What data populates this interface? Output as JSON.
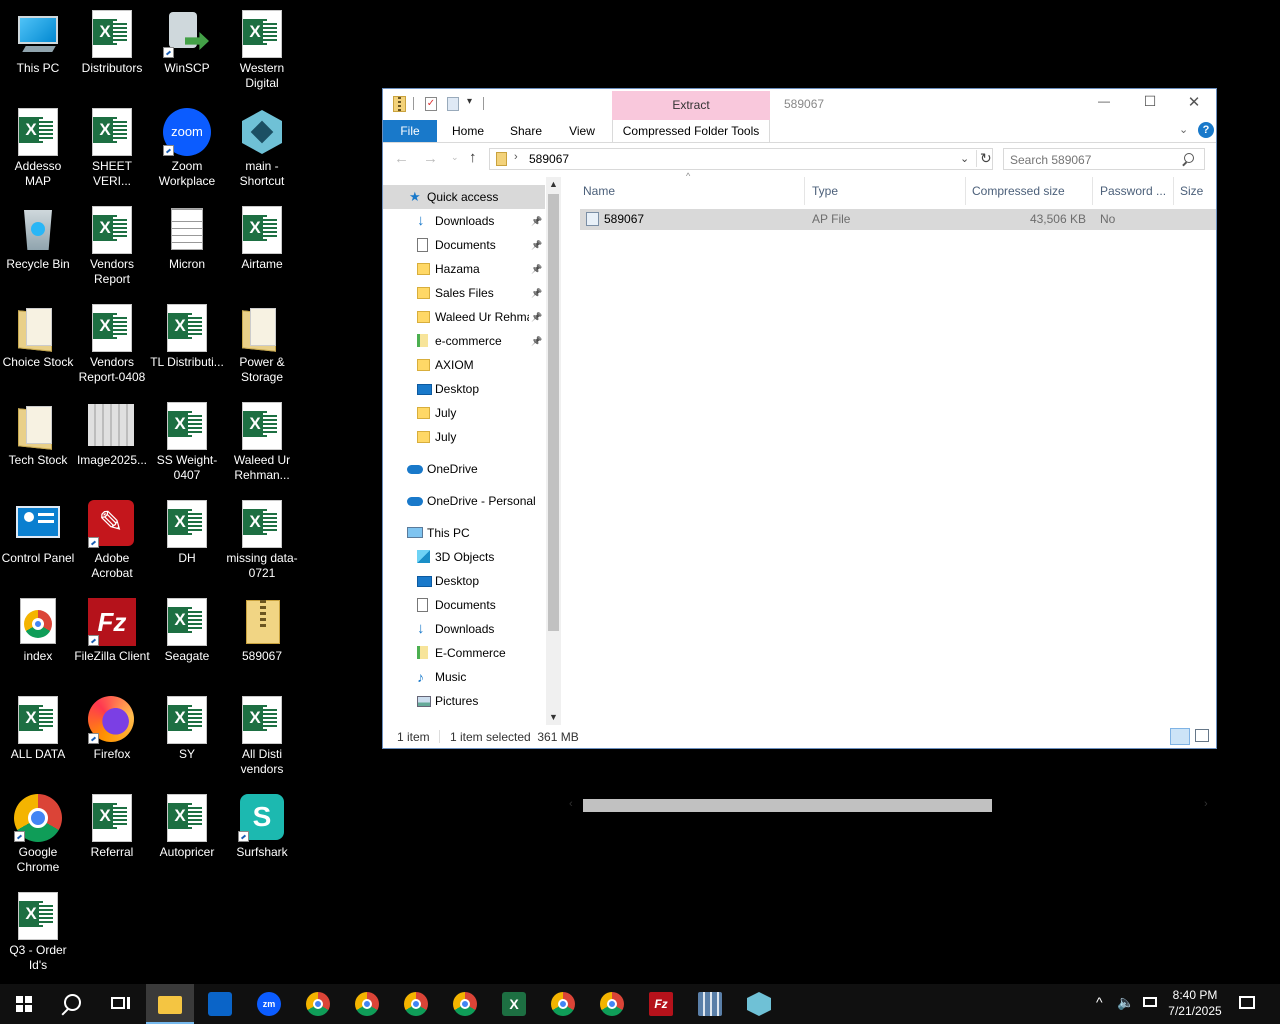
{
  "desktop": {
    "icons": [
      {
        "label": "This PC",
        "type": "pc",
        "shortcut": false
      },
      {
        "label": "Distributors",
        "type": "excel",
        "shortcut": false
      },
      {
        "label": "WinSCP",
        "type": "winscp",
        "shortcut": true
      },
      {
        "label": "Western Digital",
        "type": "excel",
        "shortcut": false
      },
      {
        "label": "Addesso MAP",
        "type": "excel",
        "shortcut": false
      },
      {
        "label": "SHEET VERI...",
        "type": "excel",
        "shortcut": false
      },
      {
        "label": "Zoom Workplace",
        "type": "zoom",
        "shortcut": true
      },
      {
        "label": "main - Shortcut",
        "type": "main",
        "shortcut": false
      },
      {
        "label": "Recycle Bin",
        "type": "recycle",
        "shortcut": false
      },
      {
        "label": "Vendors Report",
        "type": "excel",
        "shortcut": false
      },
      {
        "label": "Micron",
        "type": "doc",
        "shortcut": false
      },
      {
        "label": "Airtame",
        "type": "excel",
        "shortcut": false
      },
      {
        "label": "Choice Stock",
        "type": "folder",
        "shortcut": false
      },
      {
        "label": "Vendors Report-0408",
        "type": "excel",
        "shortcut": false
      },
      {
        "label": "TL Distributi...",
        "type": "excel",
        "shortcut": false
      },
      {
        "label": "Power & Storage",
        "type": "folder",
        "shortcut": false
      },
      {
        "label": "Tech Stock",
        "type": "folder",
        "shortcut": false
      },
      {
        "label": "Image2025...",
        "type": "image",
        "shortcut": false
      },
      {
        "label": "SS Weight-0407",
        "type": "excel",
        "shortcut": false
      },
      {
        "label": "Waleed Ur Rehman...",
        "type": "excel",
        "shortcut": false
      },
      {
        "label": "Control Panel",
        "type": "control",
        "shortcut": false
      },
      {
        "label": "Adobe Acrobat",
        "type": "acrobat",
        "shortcut": true
      },
      {
        "label": "DH",
        "type": "excel",
        "shortcut": false
      },
      {
        "label": "missing data-0721",
        "type": "excel",
        "shortcut": false
      },
      {
        "label": "index",
        "type": "chrome-doc",
        "shortcut": false
      },
      {
        "label": "FileZilla Client",
        "type": "filezilla",
        "shortcut": true
      },
      {
        "label": "Seagate",
        "type": "excel",
        "shortcut": false
      },
      {
        "label": "589067",
        "type": "zip",
        "shortcut": false
      },
      {
        "label": "ALL DATA",
        "type": "excel",
        "shortcut": false
      },
      {
        "label": "Firefox",
        "type": "firefox",
        "shortcut": true
      },
      {
        "label": "SY",
        "type": "excel",
        "shortcut": false
      },
      {
        "label": "All Disti vendors",
        "type": "excel",
        "shortcut": false
      },
      {
        "label": "Google Chrome",
        "type": "chrome",
        "shortcut": true
      },
      {
        "label": "Referral",
        "type": "excel",
        "shortcut": false
      },
      {
        "label": "Autopricer",
        "type": "excel",
        "shortcut": false
      },
      {
        "label": "Surfshark",
        "type": "surfshark",
        "shortcut": true
      },
      {
        "label": "Q3 - Order Id's",
        "type": "excel",
        "shortcut": false
      }
    ]
  },
  "explorer": {
    "title": "589067",
    "context_tab": "Extract",
    "controls": {
      "minimize": "—",
      "maximize": "☐",
      "close": "✕"
    },
    "ribbon_tabs": {
      "file": "File",
      "home": "Home",
      "share": "Share",
      "view": "View",
      "compressed": "Compressed Folder Tools"
    },
    "address": {
      "path": "589067",
      "search_placeholder": "Search 589067"
    },
    "nav": {
      "quick_access": "Quick access",
      "quick_items": [
        {
          "label": "Downloads",
          "icon": "download-arrow-icon",
          "pinned": true
        },
        {
          "label": "Documents",
          "icon": "document-icon",
          "pinned": true
        },
        {
          "label": "Hazama",
          "icon": "folder-icon",
          "pinned": true
        },
        {
          "label": "Sales Files",
          "icon": "folder-icon",
          "pinned": true
        },
        {
          "label": "Waleed Ur Rehman",
          "icon": "folder-icon",
          "pinned": true
        },
        {
          "label": "e-commerce",
          "icon": "folder-green-icon",
          "pinned": true
        },
        {
          "label": "AXIOM",
          "icon": "folder-icon",
          "pinned": false
        },
        {
          "label": "Desktop",
          "icon": "desktop-icon",
          "pinned": false
        },
        {
          "label": "July",
          "icon": "folder-icon",
          "pinned": false
        },
        {
          "label": "July",
          "icon": "folder-icon",
          "pinned": false
        }
      ],
      "onedrive": "OneDrive",
      "onedrive_personal": "OneDrive - Personal",
      "this_pc": "This PC",
      "pc_items": [
        {
          "label": "3D Objects",
          "icon": "cube-icon"
        },
        {
          "label": "Desktop",
          "icon": "desktop-icon"
        },
        {
          "label": "Documents",
          "icon": "document-icon"
        },
        {
          "label": "Downloads",
          "icon": "download-arrow-icon"
        },
        {
          "label": "E-Commerce",
          "icon": "folder-green-icon"
        },
        {
          "label": "Music",
          "icon": "music-icon"
        },
        {
          "label": "Pictures",
          "icon": "pictures-icon"
        }
      ]
    },
    "columns": {
      "name": "Name",
      "type": "Type",
      "compressed_size": "Compressed size",
      "password": "Password ...",
      "size": "Size"
    },
    "files": [
      {
        "name": "589067",
        "type": "AP File",
        "compressed_size": "43,506 KB",
        "password": "No"
      }
    ],
    "status": {
      "count": "1 item",
      "selected": "1 item selected  361 MB"
    }
  },
  "taskbar": {
    "time": "8:40 PM",
    "date": "7/21/2025",
    "apps": [
      "file-explorer",
      "outlook",
      "zoom",
      "chrome-w",
      "chrome-a",
      "chrome-b",
      "chrome-c",
      "excel",
      "chrome-d",
      "chrome-e",
      "filezilla",
      "calculator",
      "main"
    ]
  },
  "colors": {
    "accent": "#0078d7",
    "context_tab": "#f9c8dc",
    "selected_row": "#d9d9d9",
    "excel_green": "#1d6f42",
    "taskbar": "#101010"
  }
}
